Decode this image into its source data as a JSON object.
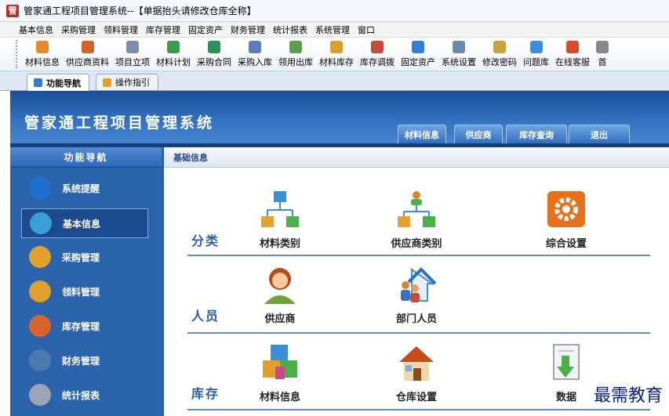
{
  "window": {
    "title": "管家通工程项目管理系统--【单据抬头请修改仓库全称】"
  },
  "menu": [
    "基本信息",
    "采购管理",
    "领料管理",
    "库存管理",
    "固定资产",
    "财务管理",
    "统计报表",
    "系统管理",
    "窗口"
  ],
  "toolbar": [
    {
      "label": "材料信息",
      "color": "#e58a2a"
    },
    {
      "label": "供应商资料",
      "color": "#d4602a"
    },
    {
      "label": "项目立项",
      "color": "#7d8ea5"
    },
    {
      "label": "材料计划",
      "color": "#3d9a4f"
    },
    {
      "label": "采购合同",
      "color": "#2f8f5b"
    },
    {
      "label": "采购入库",
      "color": "#5a7fc0"
    },
    {
      "label": "领用出库",
      "color": "#5aa04a"
    },
    {
      "label": "材料库存",
      "color": "#d8a22a"
    },
    {
      "label": "库存调拨",
      "color": "#c84a3a"
    },
    {
      "label": "固定资产",
      "color": "#2f7fd4"
    },
    {
      "label": "系统设置",
      "color": "#6a8ab0"
    },
    {
      "label": "修改密码",
      "color": "#c9a43a"
    },
    {
      "label": "问题库",
      "color": "#3a8fd8"
    },
    {
      "label": "在线客服",
      "color": "#d84a2a"
    },
    {
      "label": "首",
      "color": "#888888"
    }
  ],
  "tabs": [
    {
      "label": "功能导航",
      "active": true
    },
    {
      "label": "操作指引",
      "active": false
    }
  ],
  "header": {
    "title": "管家通工程项目管理系统",
    "tabs": [
      "材料信息",
      "供应商",
      "库存查询",
      "退出"
    ]
  },
  "sidebar": {
    "title": "功能导航",
    "items": [
      {
        "label": "系统提醒",
        "color": "#1d6fd0"
      },
      {
        "label": "基本信息",
        "color": "#3aa0d8"
      },
      {
        "label": "采购管理",
        "color": "#e0a02a"
      },
      {
        "label": "领料管理",
        "color": "#e0a02a"
      },
      {
        "label": "库存管理",
        "color": "#d8642a"
      },
      {
        "label": "财务管理",
        "color": "#4a7ab0"
      },
      {
        "label": "统计报表",
        "color": "#9aa4b4"
      }
    ],
    "active_index": 1
  },
  "main": {
    "breadcrumb": "基础信息",
    "sections": [
      {
        "label": "分类",
        "items": [
          {
            "label": "材料类别",
            "icon": "hierarchy-icon"
          },
          {
            "label": "供应商类别",
            "icon": "org-person-icon"
          },
          {
            "label": "综合设置",
            "icon": "gear-icon"
          }
        ]
      },
      {
        "label": "人员",
        "items": [
          {
            "label": "供应商",
            "icon": "person-icon"
          },
          {
            "label": "部门人员",
            "icon": "house-people-icon"
          }
        ]
      },
      {
        "label": "库存",
        "items": [
          {
            "label": "材料信息",
            "icon": "cubes-icon"
          },
          {
            "label": "仓库设置",
            "icon": "house-icon"
          },
          {
            "label": "数据",
            "icon": "document-download-icon"
          }
        ]
      }
    ]
  },
  "watermark": "最需教育"
}
